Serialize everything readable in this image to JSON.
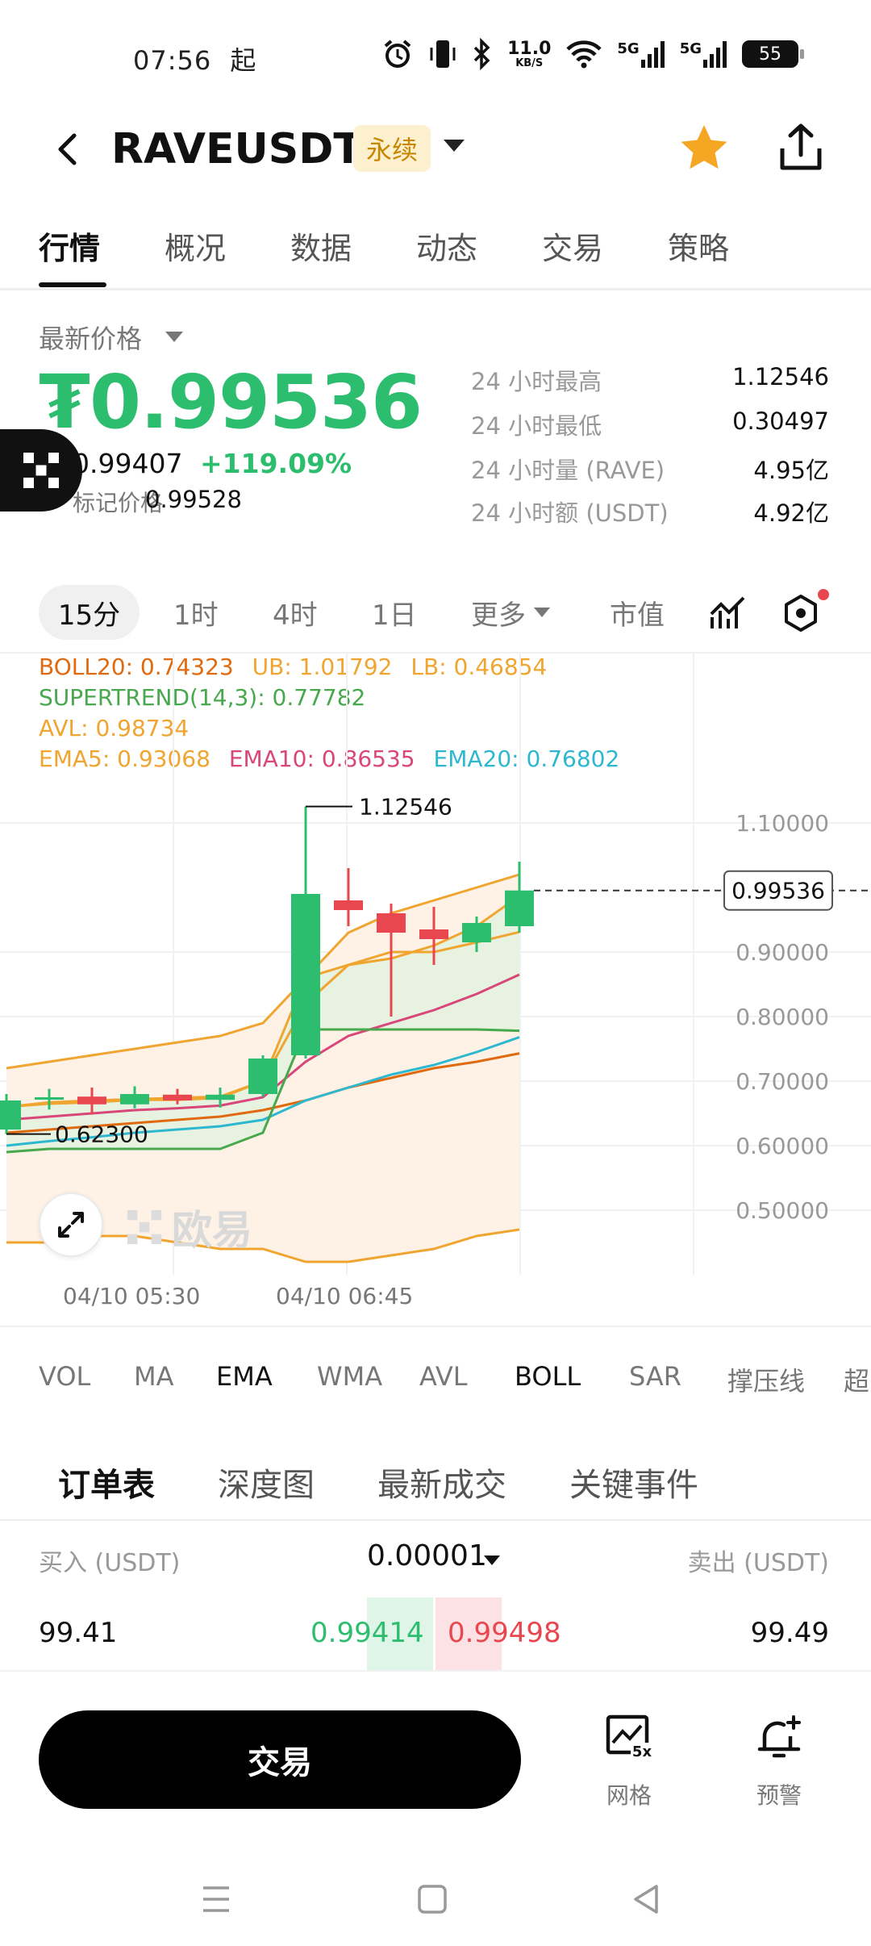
{
  "status_bar": {
    "time": "07:56",
    "extra": "起",
    "net_speed_value": "11.0",
    "net_speed_unit": "KB/S",
    "signal_1": "5G",
    "signal_2": "5G",
    "battery": "55"
  },
  "header": {
    "pair": "RAVEUSDT",
    "badge": "永续"
  },
  "main_tabs": [
    "行情",
    "概况",
    "数据",
    "动态",
    "交易",
    "策略"
  ],
  "price": {
    "label": "最新价格",
    "last": "₮0.99536",
    "index_price": "0.99407",
    "change": "+119.09%",
    "mark_label": "标记价格",
    "mark_value": "0.99528"
  },
  "stats": [
    {
      "label": "24 小时最高",
      "value": "1.12546"
    },
    {
      "label": "24 小时最低",
      "value": "0.30497"
    },
    {
      "label": "24 小时量 (RAVE)",
      "value": "4.95亿"
    },
    {
      "label": "24 小时额 (USDT)",
      "value": "4.92亿"
    }
  ],
  "timeframes": {
    "active": "15分",
    "items": [
      "1时",
      "4时",
      "1日"
    ],
    "more": "更多",
    "market_cap": "市值"
  },
  "indicators": {
    "boll": "BOLL20: 0.74323",
    "ub": "UB: 1.01792",
    "lb": "LB: 0.46854",
    "supertrend": "SUPERTREND(14,3): 0.77782",
    "avl": "AVL: 0.98734",
    "ema5": "EMA5: 0.93068",
    "ema10": "EMA10: 0.86535",
    "ema20": "EMA20: 0.76802"
  },
  "colors": {
    "up": "#2dbd6e",
    "down": "#e8474f",
    "boll": "#e06a0f",
    "boll_band": "#f0a530",
    "supertrend": "#48a84e",
    "avl": "#f0a530",
    "ema5": "#f0a530",
    "ema10": "#d9467a",
    "ema20": "#2eb8d0"
  },
  "chart_data": {
    "type": "candlestick",
    "x_ticks": [
      "04/10 05:30",
      "04/10 06:45"
    ],
    "y_ticks": [
      "1.10000",
      "0.90000",
      "0.80000",
      "0.70000",
      "0.60000",
      "0.50000"
    ],
    "ylim": [
      0.4,
      1.2
    ],
    "current_price": "0.99536",
    "high_label": "1.12546",
    "low_label": "0.62300",
    "candles": [
      {
        "o": 0.625,
        "h": 0.68,
        "l": 0.618,
        "c": 0.67
      },
      {
        "o": 0.672,
        "h": 0.688,
        "l": 0.656,
        "c": 0.675
      },
      {
        "o": 0.676,
        "h": 0.69,
        "l": 0.648,
        "c": 0.664
      },
      {
        "o": 0.664,
        "h": 0.692,
        "l": 0.658,
        "c": 0.68
      },
      {
        "o": 0.679,
        "h": 0.688,
        "l": 0.664,
        "c": 0.67
      },
      {
        "o": 0.671,
        "h": 0.69,
        "l": 0.659,
        "c": 0.679
      },
      {
        "o": 0.68,
        "h": 0.74,
        "l": 0.676,
        "c": 0.735
      },
      {
        "o": 0.74,
        "h": 1.12546,
        "l": 0.735,
        "c": 0.99
      },
      {
        "o": 0.98,
        "h": 1.03,
        "l": 0.94,
        "c": 0.965
      },
      {
        "o": 0.96,
        "h": 0.975,
        "l": 0.8,
        "c": 0.93
      },
      {
        "o": 0.935,
        "h": 0.97,
        "l": 0.88,
        "c": 0.92
      },
      {
        "o": 0.915,
        "h": 0.955,
        "l": 0.9,
        "c": 0.945
      },
      {
        "o": 0.94,
        "h": 1.04,
        "l": 0.93,
        "c": 0.99536
      }
    ],
    "lines": {
      "ub": [
        0.72,
        0.73,
        0.74,
        0.75,
        0.76,
        0.77,
        0.79,
        0.86,
        0.93,
        0.96,
        0.98,
        1.0,
        1.02
      ],
      "lb": [
        0.45,
        0.45,
        0.46,
        0.46,
        0.45,
        0.44,
        0.44,
        0.42,
        0.42,
        0.43,
        0.44,
        0.46,
        0.47
      ],
      "boll": [
        0.62,
        0.625,
        0.63,
        0.635,
        0.64,
        0.645,
        0.655,
        0.67,
        0.69,
        0.705,
        0.72,
        0.73,
        0.743
      ],
      "supertrend": [
        0.59,
        0.595,
        0.595,
        0.595,
        0.595,
        0.595,
        0.62,
        0.78,
        0.78,
        0.78,
        0.78,
        0.78,
        0.778
      ],
      "avl": [
        0.66,
        0.667,
        0.67,
        0.672,
        0.674,
        0.676,
        0.7,
        0.86,
        0.88,
        0.89,
        0.91,
        0.94,
        0.987
      ],
      "ema5": [
        0.66,
        0.665,
        0.667,
        0.671,
        0.671,
        0.674,
        0.7,
        0.82,
        0.88,
        0.9,
        0.9,
        0.915,
        0.931
      ],
      "ema10": [
        0.64,
        0.645,
        0.65,
        0.655,
        0.658,
        0.662,
        0.675,
        0.73,
        0.77,
        0.79,
        0.81,
        0.835,
        0.865
      ],
      "ema20": [
        0.6,
        0.607,
        0.613,
        0.62,
        0.625,
        0.63,
        0.64,
        0.67,
        0.69,
        0.71,
        0.725,
        0.745,
        0.768
      ]
    }
  },
  "indicator_tabs": [
    "VOL",
    "MA",
    "EMA",
    "WMA",
    "AVL",
    "BOLL",
    "SAR",
    "撑压线",
    "超"
  ],
  "book_tabs": [
    "订单表",
    "深度图",
    "最新成交",
    "关键事件"
  ],
  "book": {
    "bid_header": "买入 (USDT)",
    "precision": "0.00001",
    "ask_header": "卖出 (USDT)",
    "bid_qty": "99.41",
    "bid_price": "0.99414",
    "ask_price": "0.99498",
    "ask_qty": "99.49"
  },
  "bottom": {
    "trade": "交易",
    "grid": "网格",
    "grid_badge": "5x",
    "alert": "预警"
  },
  "watermark": "欧易"
}
